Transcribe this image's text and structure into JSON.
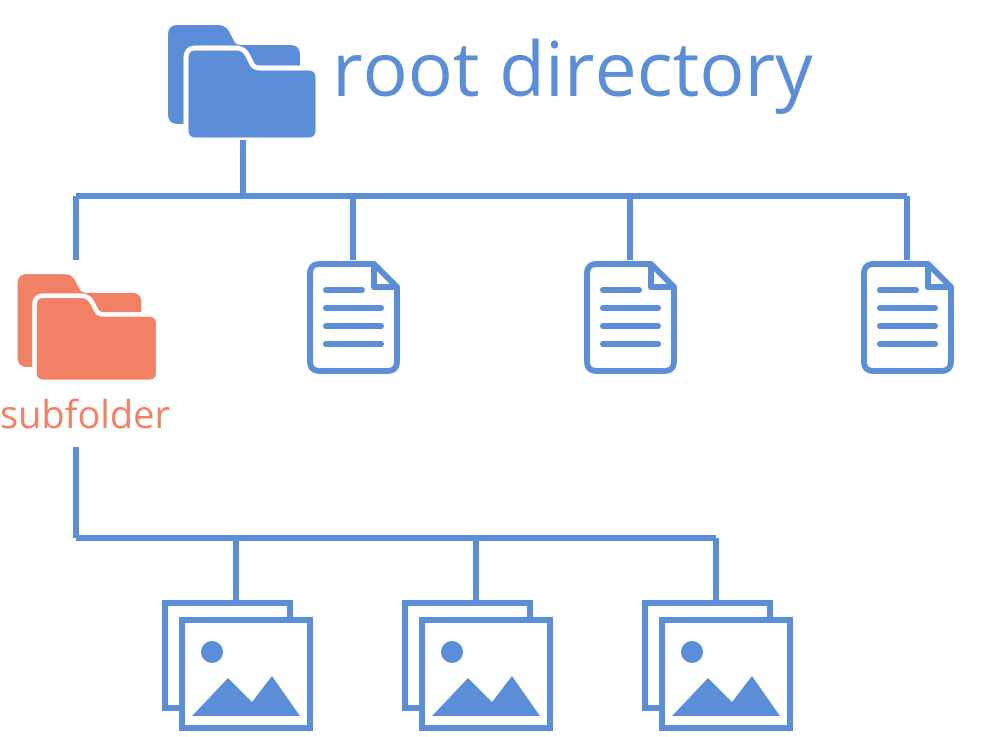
{
  "colors": {
    "blue": "#5B8DD9",
    "blue_light_fill": "#5B8DD9",
    "salmon": "#F28064",
    "white": "#FFFFFF"
  },
  "root": {
    "label": "root directory",
    "icon": "folder-icon",
    "color": "blue"
  },
  "root_children": [
    {
      "type": "folder",
      "label": "subfolder",
      "color": "salmon"
    },
    {
      "type": "document"
    },
    {
      "type": "document"
    },
    {
      "type": "document"
    }
  ],
  "subfolder_children": [
    {
      "type": "image"
    },
    {
      "type": "image"
    },
    {
      "type": "image"
    }
  ]
}
